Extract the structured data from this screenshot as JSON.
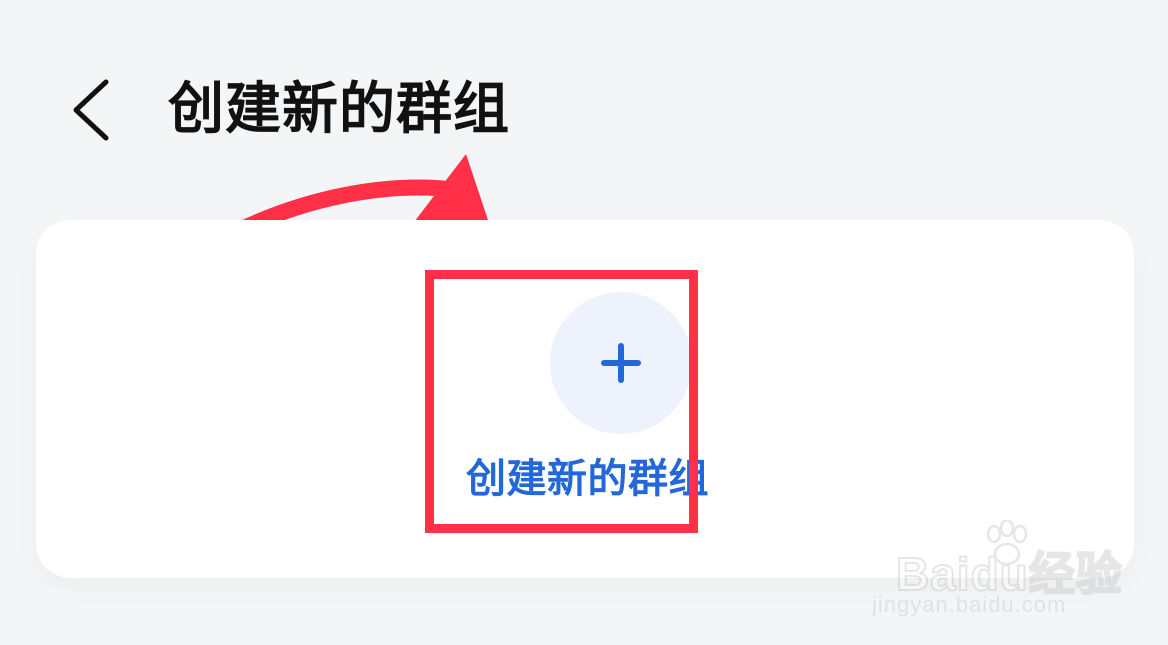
{
  "header": {
    "back_icon": "chevron-left-icon",
    "title": "创建新的群组"
  },
  "card": {
    "create_button": {
      "icon": "plus-icon",
      "label": "创建新的群组"
    }
  },
  "annotation": {
    "highlight_color": "#ff3047",
    "arrow_color": "#ff3047"
  },
  "watermark": {
    "brand": "Baidu经验",
    "url": "jingyan.baidu.com"
  },
  "colors": {
    "background": "#f4f5f7",
    "card": "#ffffff",
    "accent": "#2467d8",
    "icon_circle": "#edf2fd"
  }
}
